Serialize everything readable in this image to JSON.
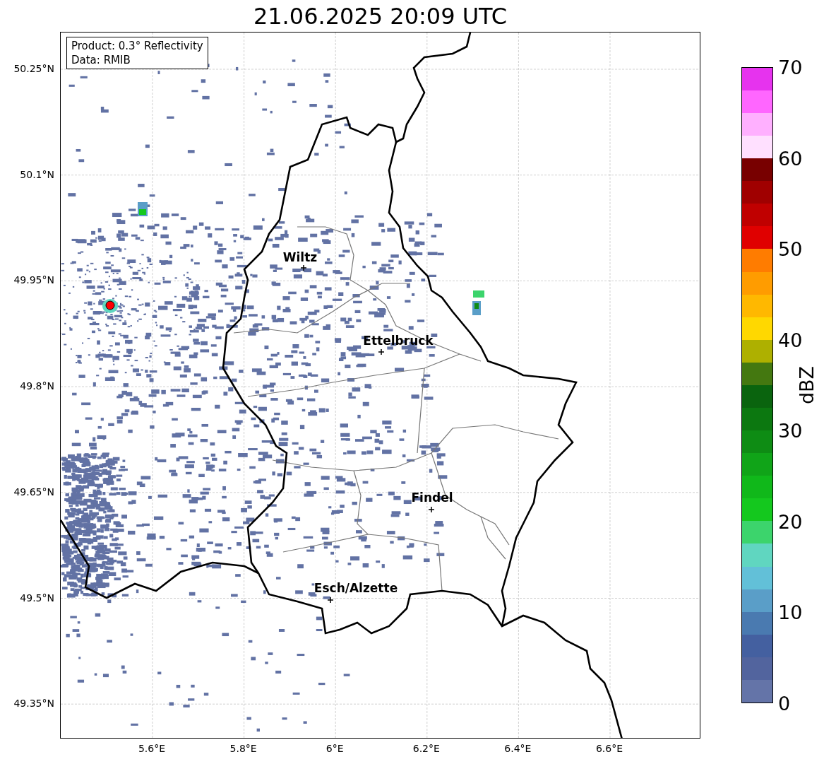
{
  "title": "21.06.2025 20:09 UTC",
  "info_box": {
    "lines": [
      "Product: 0.3° Reflectivity",
      "Data: RMIB"
    ]
  },
  "map": {
    "lat_ticks": [
      "50.25°N",
      "50.1°N",
      "49.95°N",
      "49.8°N",
      "49.65°N",
      "49.5°N",
      "49.35°N"
    ],
    "lon_ticks": [
      "5.6°E",
      "5.8°E",
      "6°E",
      "6.2°E",
      "6.4°E",
      "6.6°E"
    ],
    "cities": [
      {
        "name": "Wiltz"
      },
      {
        "name": "Ettelbruck"
      },
      {
        "name": "Findel"
      },
      {
        "name": "Esch/Alzette"
      }
    ]
  },
  "colorbar": {
    "label": "dBZ",
    "ticks": [
      "70",
      "60",
      "50",
      "40",
      "30",
      "20",
      "10",
      "0"
    ],
    "bins": [
      {
        "color": "#6474a8"
      },
      {
        "color": "#52649e"
      },
      {
        "color": "#4460a0"
      },
      {
        "color": "#4a7ab0"
      },
      {
        "color": "#5a9ec8"
      },
      {
        "color": "#62c0d8"
      },
      {
        "color": "#60d6c0"
      },
      {
        "color": "#3cd46c"
      },
      {
        "color": "#14c81e"
      },
      {
        "color": "#10b81a"
      },
      {
        "color": "#10a418"
      },
      {
        "color": "#0e8c14"
      },
      {
        "color": "#0c7810"
      },
      {
        "color": "#0a640e"
      },
      {
        "color": "#447810"
      },
      {
        "color": "#aeb000"
      },
      {
        "color": "#ffd800"
      },
      {
        "color": "#ffb800"
      },
      {
        "color": "#ff9c00"
      },
      {
        "color": "#ff7c00"
      },
      {
        "color": "#e00000"
      },
      {
        "color": "#c00000"
      },
      {
        "color": "#a00000"
      },
      {
        "color": "#780000"
      },
      {
        "color": "#ffe0ff"
      },
      {
        "color": "#ffb0ff"
      },
      {
        "color": "#ff66ff"
      },
      {
        "color": "#e633ee"
      }
    ]
  }
}
